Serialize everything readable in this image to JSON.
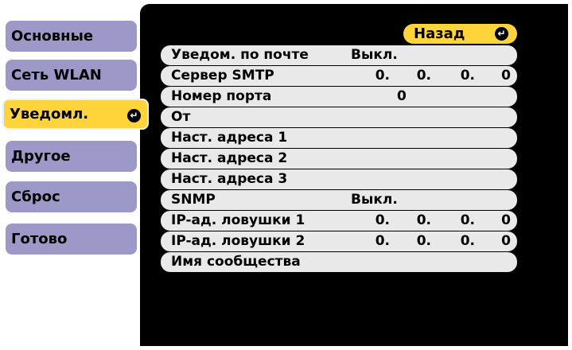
{
  "tabs": [
    {
      "label": "Основные"
    },
    {
      "label": "Сеть WLAN"
    },
    {
      "label": "Уведомл.",
      "active": true
    },
    {
      "label": "Другое"
    },
    {
      "label": "Сброс"
    },
    {
      "label": "Готово"
    }
  ],
  "back_button": {
    "label": "Назад"
  },
  "rows": {
    "mail_notify": {
      "label": "Уведом. по почте",
      "value": "Выкл."
    },
    "smtp_server": {
      "label": "Сервер SMTP",
      "octets": [
        "0.",
        "0.",
        "0.",
        "0"
      ]
    },
    "port": {
      "label": "Номер порта",
      "value": "0"
    },
    "from": {
      "label": "От"
    },
    "addr1": {
      "label": "Наст. адреса 1"
    },
    "addr2": {
      "label": "Наст. адреса 2"
    },
    "addr3": {
      "label": "Наст. адреса 3"
    },
    "snmp": {
      "label": "SNMP",
      "value": "Выкл."
    },
    "trap1": {
      "label": "IP-ад. ловушки 1",
      "octets": [
        "0.",
        "0.",
        "0.",
        "0"
      ]
    },
    "trap2": {
      "label": "IP-ад. ловушки 2",
      "octets": [
        "0.",
        "0.",
        "0.",
        "0"
      ]
    },
    "community": {
      "label": "Имя сообщества"
    }
  },
  "colors": {
    "tab_inactive": "#9c98c8",
    "tab_active": "#ffd43b",
    "row_bg": "#e9e9e9",
    "screen_bg": "#000000"
  },
  "icons": {
    "enter": "enter-return-icon"
  }
}
